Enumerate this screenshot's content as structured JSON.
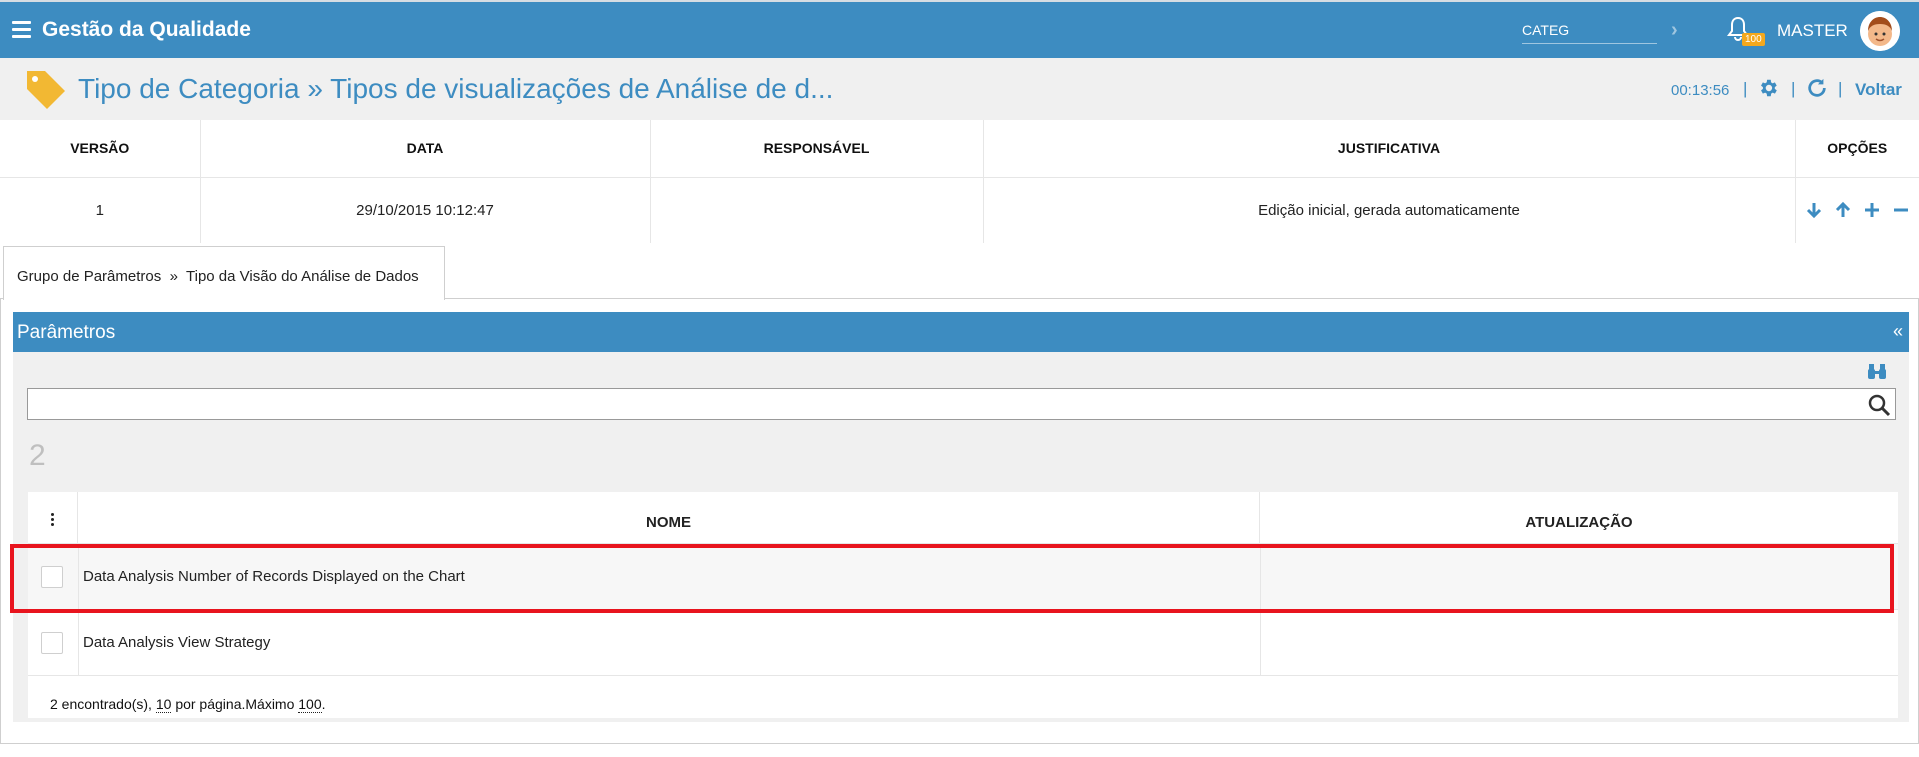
{
  "header": {
    "app_title": "Gestão da Qualidade",
    "search_value": "CATEG",
    "notification_count": "100",
    "user_name": "MASTER"
  },
  "titlebar": {
    "title": "Tipo de Categoria » Tipos de visualizações de Análise de d...",
    "timer": "00:13:56",
    "back_label": "Voltar"
  },
  "versions": {
    "columns": [
      "VERSÃO",
      "DATA",
      "RESPONSÁVEL",
      "JUSTIFICATIVA",
      "OPÇÕES"
    ],
    "rows": [
      {
        "versao": "1",
        "data": "29/10/2015 10:12:47",
        "responsavel": "",
        "justificativa": "Edição inicial, gerada automaticamente"
      }
    ]
  },
  "breadcrumb_tab": {
    "part1": "Grupo de Parâmetros",
    "separator": "»",
    "part2": "Tipo da Visão do Análise de Dados"
  },
  "panel": {
    "title": "Parâmetros",
    "collapse_symbol": "«",
    "search_value": "",
    "count": "2",
    "columns": {
      "nome": "NOME",
      "atualizacao": "ATUALIZAÇÃO"
    },
    "rows": [
      {
        "nome": "Data Analysis Number of Records Displayed on the Chart",
        "atualizacao": ""
      },
      {
        "nome": "Data Analysis View Strategy",
        "atualizacao": ""
      }
    ],
    "footer": {
      "found": "2 encontrado(s),",
      "per_page_num": "10",
      "per_page_label": "por página.Máximo",
      "max_num": "100",
      "end": "."
    }
  },
  "colors": {
    "primary": "#3d8cc1",
    "highlight": "#e8141e",
    "badge": "#f4a81d"
  }
}
